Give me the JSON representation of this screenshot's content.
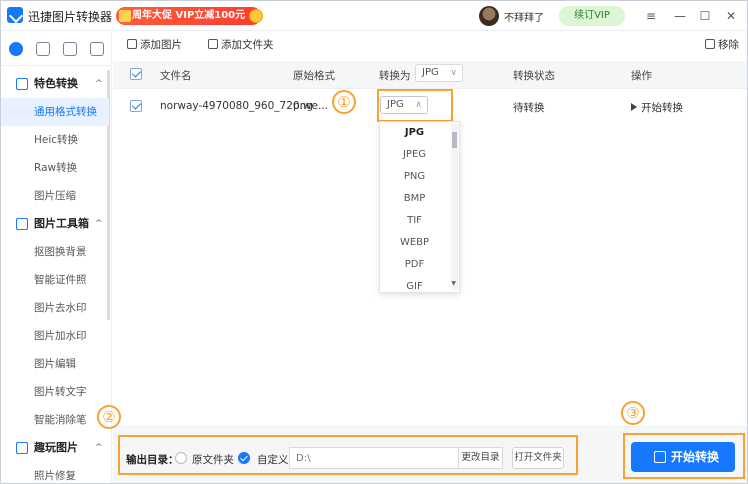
{
  "app": {
    "title": "迅捷图片转换器",
    "promo": "周年大促 VIP立减100元",
    "username": "不拜拜了",
    "vip_button": "续订VIP"
  },
  "window_controls": {
    "skin": "👕",
    "menu": "≡",
    "minimize": "—",
    "maximize": "☐",
    "close": "✕"
  },
  "sidebar": {
    "sections": [
      {
        "title": "特色转换",
        "items": [
          "通用格式转换",
          "Heic转换",
          "Raw转换",
          "图片压缩"
        ]
      },
      {
        "title": "图片工具箱",
        "items": [
          "抠图换背景",
          "智能证件照",
          "图片去水印",
          "图片加水印",
          "图片编辑",
          "图片转文字",
          "智能消除笔"
        ]
      },
      {
        "title": "趣玩图片",
        "items": [
          "照片修复"
        ]
      }
    ],
    "selected": "通用格式转换"
  },
  "toolbar": {
    "add_image": "添加图片",
    "add_folder": "添加文件夹",
    "remove": "移除"
  },
  "table": {
    "headers": {
      "filename": "文件名",
      "original_format": "原始格式",
      "convert_to": "转换为",
      "status": "转换状态",
      "action": "操作"
    },
    "header_format_value": "JPG",
    "rows": [
      {
        "filename": "norway-4970080_960_720.we...",
        "original_format": "png",
        "convert_to": "JPG",
        "status": "待转换",
        "action": "开始转换"
      }
    ]
  },
  "dropdown": {
    "options": [
      "JPG",
      "JPEG",
      "PNG",
      "BMP",
      "TIF",
      "WEBP",
      "PDF",
      "GIF"
    ],
    "selected": "JPG"
  },
  "bottom": {
    "output_label": "输出目录：",
    "option_original": "原文件夹",
    "option_custom": "自定义",
    "path_placeholder": "D:\\",
    "change_dir": "更改目录",
    "open_folder": "打开文件夹",
    "start": "开始转换"
  },
  "annotations": [
    "①",
    "②",
    "③"
  ],
  "colors": {
    "accent": "#1677ff",
    "annotation": "#f7a233",
    "promo": "#ff3b2f"
  }
}
